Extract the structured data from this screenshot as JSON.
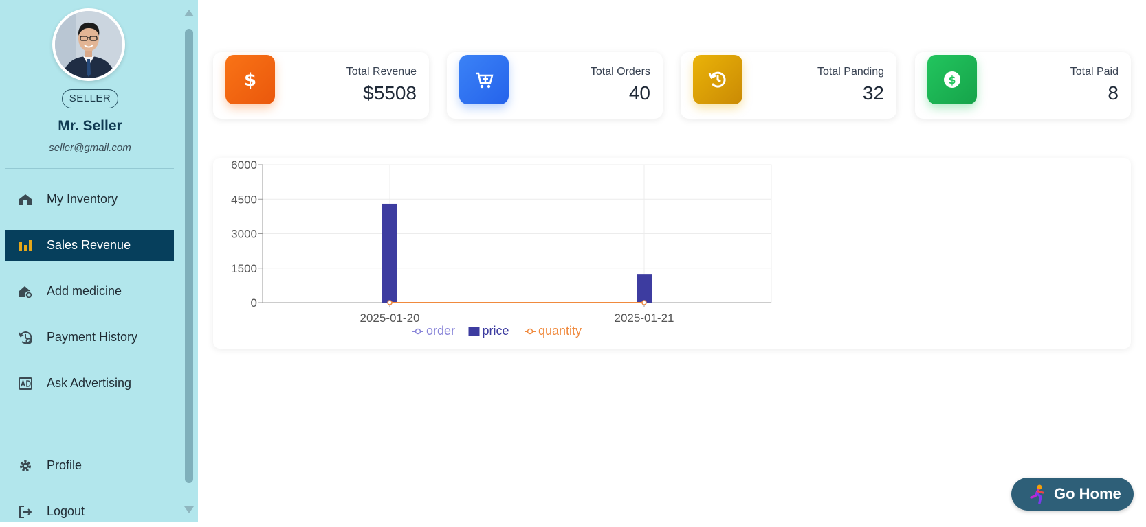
{
  "sidebar": {
    "role": "SELLER",
    "name": "Mr. Seller",
    "email": "seller@gmail.com",
    "nav": [
      {
        "label": "My Inventory",
        "icon": "warehouse-icon",
        "active": false
      },
      {
        "label": "Sales Revenue",
        "icon": "bar-chart-icon",
        "active": true
      },
      {
        "label": "Add medicine",
        "icon": "house-medical-icon",
        "active": false
      },
      {
        "label": "Payment History",
        "icon": "history-gear-icon",
        "active": false
      },
      {
        "label": "Ask Advertising",
        "icon": "ad-icon",
        "active": false
      }
    ],
    "bottom_nav": [
      {
        "label": "Profile",
        "icon": "gear-icon"
      },
      {
        "label": "Logout",
        "icon": "logout-icon"
      }
    ]
  },
  "stats": [
    {
      "title": "Total Revenue",
      "value": "$5508",
      "icon": "dollar-icon",
      "color": "#f97316"
    },
    {
      "title": "Total Orders",
      "value": "40",
      "icon": "cart-icon",
      "color": "#3b82f6"
    },
    {
      "title": "Total Panding",
      "value": "32",
      "icon": "history-icon",
      "color": "#eab308"
    },
    {
      "title": "Total Paid",
      "value": "8",
      "icon": "coin-icon",
      "color": "#22c55e"
    }
  ],
  "chart_data": {
    "type": "bar",
    "categories": [
      "2025-01-20",
      "2025-01-21"
    ],
    "series": [
      {
        "name": "order",
        "kind": "line",
        "color": "#8884d8",
        "values": [
          0,
          0
        ]
      },
      {
        "name": "price",
        "kind": "bar",
        "color": "#3d3ca0",
        "values": [
          4300,
          1220
        ]
      },
      {
        "name": "quantity",
        "kind": "line",
        "color": "#f08a3e",
        "values": [
          0,
          0
        ]
      }
    ],
    "yticks": [
      0,
      1500,
      3000,
      4500,
      6000
    ],
    "ylim": [
      0,
      6000
    ],
    "grid": true,
    "legend_position": "bottom"
  },
  "go_home": {
    "label": "Go Home"
  }
}
